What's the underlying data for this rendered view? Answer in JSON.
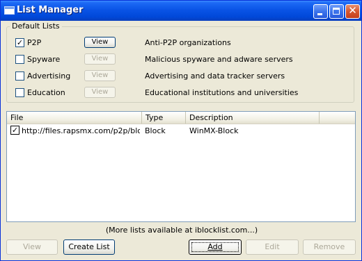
{
  "window": {
    "title": "List Manager",
    "icon": "window-icon",
    "controls": {
      "minimize": "minimize-icon",
      "maximize": "maximize-icon",
      "close": "close-icon",
      "close_glyph": "✕"
    }
  },
  "default_lists": {
    "label": "Default Lists",
    "items": [
      {
        "name": "P2P",
        "checked": true,
        "check_glyph": "✓",
        "button": "View",
        "button_enabled": true,
        "description": "Anti-P2P organizations"
      },
      {
        "name": "Spyware",
        "checked": false,
        "check_glyph": "",
        "button": "View",
        "button_enabled": false,
        "description": "Malicious spyware and adware servers"
      },
      {
        "name": "Advertising",
        "checked": false,
        "check_glyph": "",
        "button": "View",
        "button_enabled": false,
        "description": "Advertising and data tracker servers"
      },
      {
        "name": "Education",
        "checked": false,
        "check_glyph": "",
        "button": "View",
        "button_enabled": false,
        "description": "Educational institutions and universities"
      }
    ]
  },
  "file_list": {
    "columns": [
      "File",
      "Type",
      "Description"
    ],
    "rows": [
      {
        "checked": true,
        "check_glyph": "✓",
        "file": "http://files.rapsmx.com/p2p/bloc...",
        "type": "Block",
        "description": "WinMX-Block"
      }
    ]
  },
  "more_lists_text": "(More lists available at iblocklist.com...)",
  "buttons": {
    "view": {
      "label": "View",
      "enabled": false
    },
    "create_list": {
      "label": "Create List",
      "enabled": true
    },
    "add": {
      "label": "Add",
      "enabled": true,
      "default": true
    },
    "edit": {
      "label": "Edit",
      "enabled": false
    },
    "remove": {
      "label": "Remove",
      "enabled": false
    }
  },
  "colors": {
    "titlebar": "#0a54e6",
    "window_face": "#ece9d8",
    "disabled_text": "#aca899"
  }
}
